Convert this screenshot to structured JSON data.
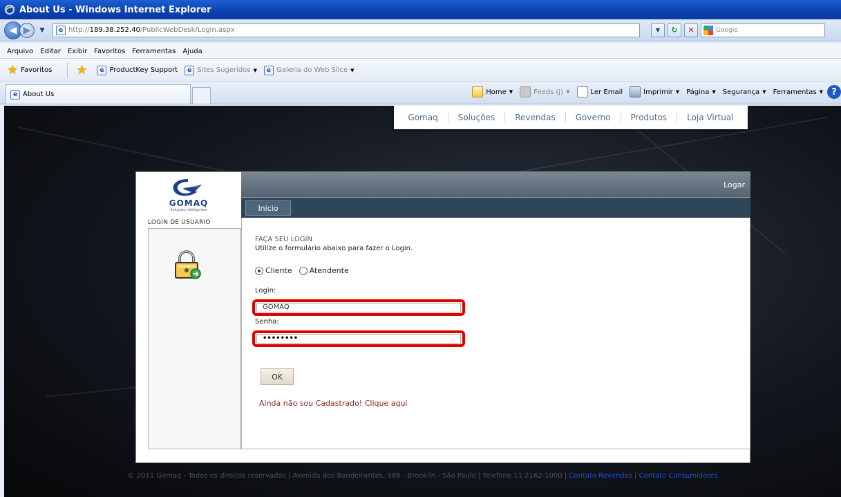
{
  "window": {
    "title": "About Us - Windows Internet Explorer"
  },
  "address": {
    "url_prefix": "http://",
    "url_host": "189.38.252.40",
    "url_path": "/PublicWebDesk/Login.aspx",
    "search_placeholder": "Google"
  },
  "menu": [
    "Arquivo",
    "Editar",
    "Exibir",
    "Favoritos",
    "Ferramentas",
    "Ajuda"
  ],
  "favorites": {
    "label": "Favoritos",
    "items": [
      "ProductKey Support",
      "Sites Sugeridos",
      "Galeria do Web Slice"
    ]
  },
  "tab": {
    "title": "About Us"
  },
  "commands": {
    "home": "Home",
    "feeds": "Feeds (J)",
    "read_mail": "Ler Email",
    "print": "Imprimir",
    "page": "Página",
    "security": "Segurança",
    "tools": "Ferramentas",
    "help": "?"
  },
  "site_nav": [
    "Gomaq",
    "Soluções",
    "Revendas",
    "Governo",
    "Produtos",
    "Loja Virtual"
  ],
  "brand": {
    "name": "GOMAQ",
    "tagline": "Soluções Inteligentes"
  },
  "panel": {
    "section_label": "LOGIN DE USUARIO",
    "header_action": "Logar",
    "tab_inicio": "Inicio"
  },
  "form": {
    "title": "FAÇA SEU LOGIN",
    "subtitle": "Utilize o formulário abaixo para fazer o Login.",
    "radio_cliente": "Cliente",
    "radio_atendente": "Atendente",
    "login_label": "Login:",
    "login_value": "GOMAQ",
    "password_label": "Senha:",
    "password_value": "••••••••",
    "ok_label": "OK",
    "register_link": "Ainda não sou Cadastrado! Clique aqui"
  },
  "footer": {
    "text": "© 2011 Gomaq - Todos os direitos reservados | Avenida dos Bandeirantes, 988 - Brooklin - São Paulo | Telefone 11 2162-1000 | ",
    "link_revendas": "Contato Revendas",
    "divider": " | ",
    "link_consumidores": "Contato Consumidores"
  },
  "colors": {
    "highlight": "#e00000",
    "accent_link": "#1f4fd0",
    "register_link": "#8b1a1a"
  }
}
